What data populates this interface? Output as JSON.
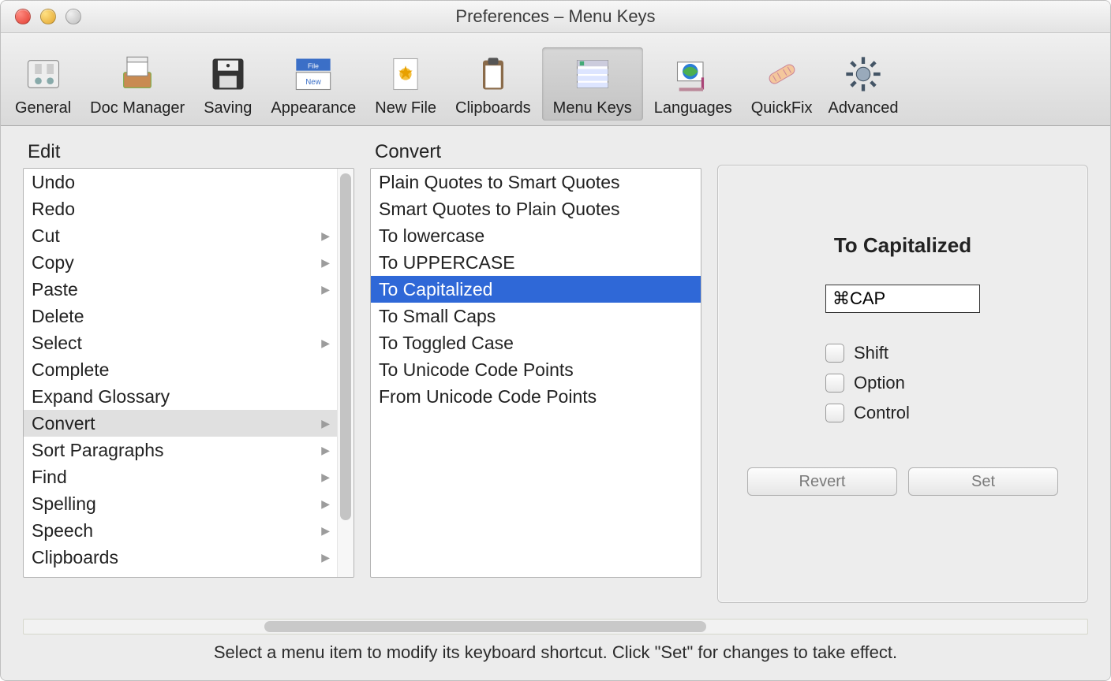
{
  "window_title": "Preferences – Menu Keys",
  "toolbar": [
    {
      "id": "general",
      "label": "General"
    },
    {
      "id": "docmanager",
      "label": "Doc Manager"
    },
    {
      "id": "saving",
      "label": "Saving"
    },
    {
      "id": "appearance",
      "label": "Appearance"
    },
    {
      "id": "newfile",
      "label": "New File"
    },
    {
      "id": "clipboards",
      "label": "Clipboards"
    },
    {
      "id": "menukeys",
      "label": "Menu Keys",
      "active": true
    },
    {
      "id": "languages",
      "label": "Languages"
    },
    {
      "id": "quickfix",
      "label": "QuickFix"
    },
    {
      "id": "advanced",
      "label": "Advanced"
    }
  ],
  "left": {
    "heading": "Edit",
    "items": [
      {
        "label": "Undo"
      },
      {
        "label": "Redo"
      },
      {
        "label": "Cut",
        "sub": true
      },
      {
        "label": "Copy",
        "sub": true
      },
      {
        "label": "Paste",
        "sub": true
      },
      {
        "label": "Delete"
      },
      {
        "label": "Select",
        "sub": true
      },
      {
        "label": "Complete"
      },
      {
        "label": "Expand Glossary"
      },
      {
        "label": "Convert",
        "sub": true,
        "hl": true
      },
      {
        "label": "Sort Paragraphs",
        "sub": true
      },
      {
        "label": "Find",
        "sub": true
      },
      {
        "label": "Spelling",
        "sub": true
      },
      {
        "label": "Speech",
        "sub": true
      },
      {
        "label": "Clipboards",
        "sub": true
      }
    ]
  },
  "middle": {
    "heading": "Convert",
    "items": [
      {
        "label": "Plain Quotes to Smart Quotes"
      },
      {
        "label": "Smart Quotes to Plain Quotes"
      },
      {
        "label": "To lowercase"
      },
      {
        "label": "To UPPERCASE"
      },
      {
        "label": "To Capitalized",
        "sel": true
      },
      {
        "label": "To Small Caps"
      },
      {
        "label": "To Toggled Case"
      },
      {
        "label": "To Unicode Code Points"
      },
      {
        "label": "From Unicode Code Points"
      }
    ]
  },
  "panel": {
    "title": "To Capitalized",
    "shortcut": "⌘CAP",
    "modifiers": {
      "shift": "Shift",
      "option": "Option",
      "control": "Control"
    },
    "buttons": {
      "revert": "Revert",
      "set": "Set"
    }
  },
  "footer": "Select a menu item to modify its keyboard shortcut.  Click \"Set\" for changes to take effect."
}
